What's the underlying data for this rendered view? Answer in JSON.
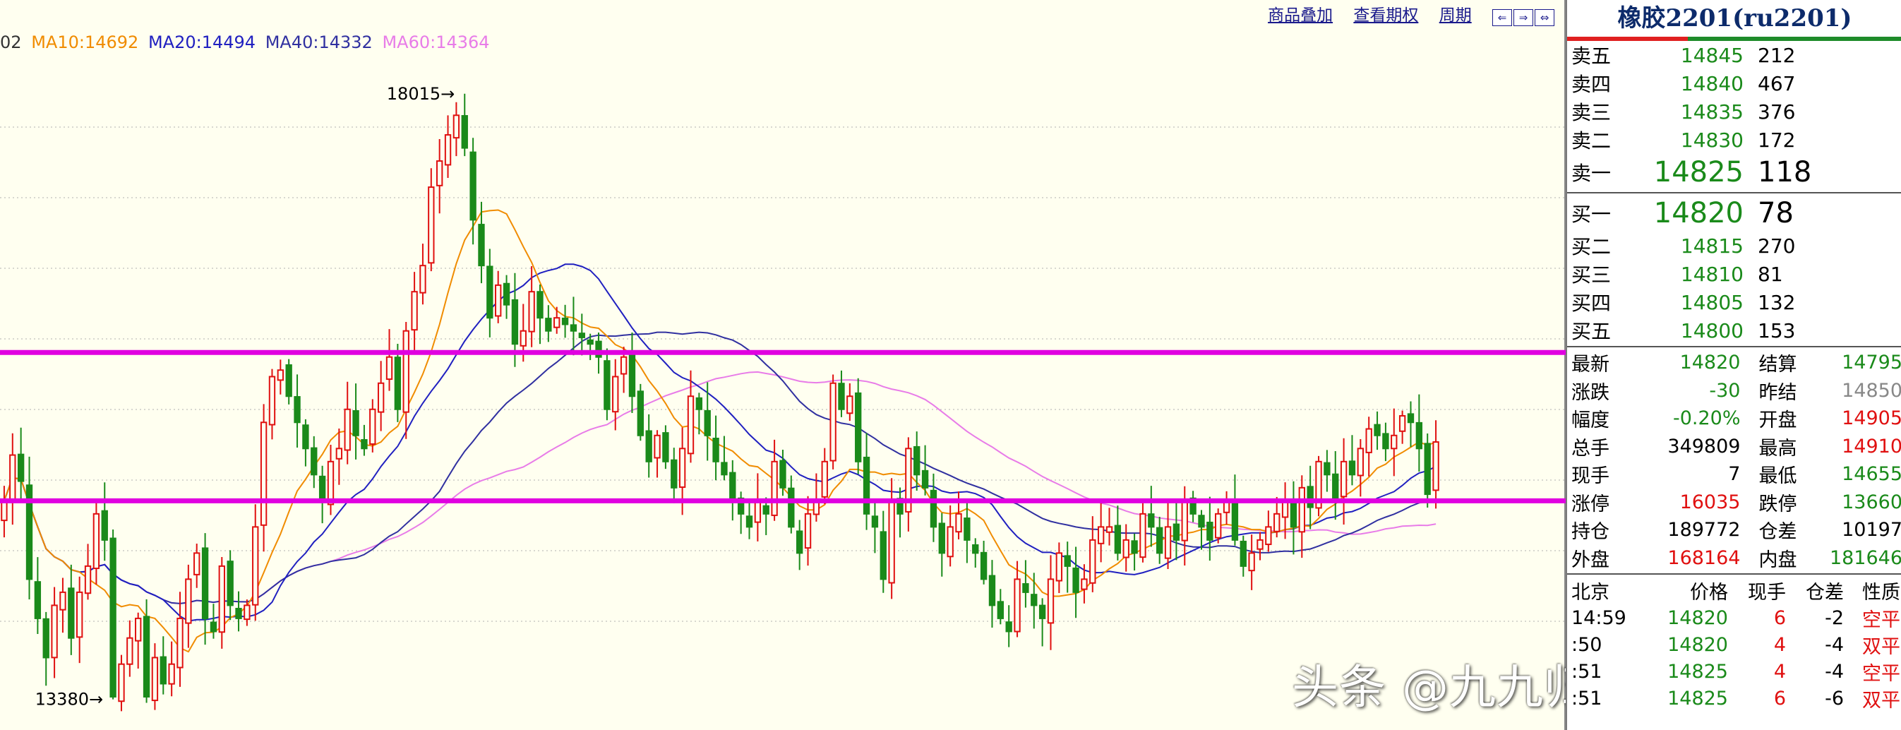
{
  "ma_bar": {
    "prefix": "02",
    "ma10": "MA10:14692",
    "ma20": "MA20:14494",
    "ma40": "MA40:14332",
    "ma60": "MA60:14364"
  },
  "top_links": {
    "overlay": "商品叠加",
    "options": "查看期权",
    "period": "周期",
    "arrows": [
      "⇐",
      "⇒",
      "⇔"
    ]
  },
  "chart_labels": {
    "high": "18015",
    "low": "13380"
  },
  "colors": {
    "up": "#e01010",
    "down": "#1a8a1a",
    "ma10": "#f08c00",
    "ma20": "#2020c0",
    "ma40": "#3030a0",
    "ma60": "#e87ce8",
    "level": "#e000e0"
  },
  "levels": [
    16035,
    14900
  ],
  "chart_data": {
    "type": "candlestick",
    "ylim": [
      13200,
      18300
    ],
    "high": 18015,
    "low": 13380,
    "closes": [
      14900,
      15250,
      15050,
      14300,
      14000,
      13700,
      14100,
      14200,
      13850,
      14200,
      14400,
      14800,
      14600,
      13400,
      13650,
      13850,
      14000,
      13400,
      13700,
      13500,
      13650,
      14000,
      14300,
      14500,
      14000,
      13900,
      14400,
      14100,
      14000,
      14100,
      14700,
      15500,
      15850,
      15900,
      15700,
      15500,
      15300,
      15100,
      14900,
      15200,
      15300,
      15600,
      15400,
      15300,
      15600,
      15800,
      16000,
      15600,
      16200,
      16500,
      16700,
      17300,
      17500,
      17700,
      17850,
      17600,
      17050,
      16700,
      16300,
      16550,
      16400,
      16100,
      16200,
      16500,
      16300,
      16200,
      16300,
      16250,
      16200,
      16150,
      16100,
      16000,
      15600,
      15850,
      16000,
      15700,
      15400,
      15200,
      15400,
      15200,
      15000,
      15300,
      15700,
      15600,
      15400,
      15200,
      15100,
      14900,
      14800,
      14700,
      14900,
      14800,
      15200,
      15000,
      14700,
      14500,
      14800,
      14900,
      15200,
      15800,
      15600,
      15700,
      15200,
      14800,
      14700,
      14300,
      14900,
      14800,
      15300,
      15100,
      15000,
      14700,
      14500,
      14700,
      14800,
      14600,
      14500,
      14300,
      14100,
      14000,
      13900,
      14300,
      14200,
      14100,
      14000,
      14300,
      14500,
      14400,
      14200,
      14300,
      14600,
      14700,
      14700,
      14500,
      14600,
      14500,
      14800,
      14700,
      14500,
      14700,
      14600,
      14900,
      14800,
      14700,
      14600,
      14800,
      14900,
      14600,
      14400,
      14500,
      14600,
      14700,
      14800,
      14900,
      14700,
      15000,
      14850,
      15200,
      15100,
      14900,
      15200,
      15100,
      15300,
      15450,
      15400,
      15300,
      15400,
      15550,
      15500,
      15300,
      14950,
      15350
    ]
  },
  "quote": {
    "title": "橡胶2201(ru2201)",
    "asks": [
      {
        "label": "卖五",
        "price": "14845",
        "vol": "212"
      },
      {
        "label": "卖四",
        "price": "14840",
        "vol": "467"
      },
      {
        "label": "卖三",
        "price": "14835",
        "vol": "376"
      },
      {
        "label": "卖二",
        "price": "14830",
        "vol": "172"
      },
      {
        "label": "卖一",
        "price": "14825",
        "vol": "118"
      }
    ],
    "bids": [
      {
        "label": "买一",
        "price": "14820",
        "vol": "78"
      },
      {
        "label": "买二",
        "price": "14815",
        "vol": "270"
      },
      {
        "label": "买三",
        "price": "14810",
        "vol": "81"
      },
      {
        "label": "买四",
        "price": "14805",
        "vol": "132"
      },
      {
        "label": "买五",
        "price": "14800",
        "vol": "153"
      }
    ],
    "stats": [
      {
        "l1": "最新",
        "v1": "14820",
        "c1": "green",
        "l2": "结算",
        "v2": "14795",
        "c2": "green"
      },
      {
        "l1": "涨跌",
        "v1": "-30",
        "c1": "green",
        "l2": "昨结",
        "v2": "14850",
        "c2": "gray"
      },
      {
        "l1": "幅度",
        "v1": "-0.20%",
        "c1": "green",
        "l2": "开盘",
        "v2": "14905",
        "c2": "red"
      },
      {
        "l1": "总手",
        "v1": "349809",
        "c1": "black",
        "l2": "最高",
        "v2": "14910",
        "c2": "red"
      },
      {
        "l1": "现手",
        "v1": "7",
        "c1": "black",
        "l2": "最低",
        "v2": "14655",
        "c2": "green"
      },
      {
        "l1": "涨停",
        "v1": "16035",
        "c1": "red",
        "l2": "跌停",
        "v2": "13660",
        "c2": "green"
      },
      {
        "l1": "持仓",
        "v1": "189772",
        "c1": "black",
        "l2": "仓差",
        "v2": "10197",
        "c2": "black"
      },
      {
        "l1": "外盘",
        "v1": "168164",
        "c1": "red",
        "l2": "内盘",
        "v2": "181646",
        "c2": "green"
      }
    ],
    "tick_header": [
      "北京",
      "价格",
      "现手",
      "仓差",
      "性质"
    ],
    "ticks": [
      {
        "time": "14:59",
        "price": "14820",
        "hand": "6",
        "diff": "-2",
        "nature": "空平"
      },
      {
        "time": ":50",
        "price": "14820",
        "hand": "4",
        "diff": "-4",
        "nature": "双平"
      },
      {
        "time": ":51",
        "price": "14825",
        "hand": "4",
        "diff": "-4",
        "nature": "空平"
      },
      {
        "time": ":51",
        "price": "14825",
        "hand": "6",
        "diff": "-6",
        "nature": "双平"
      }
    ]
  },
  "watermark": "头条 @九九归一期货徐子淇"
}
